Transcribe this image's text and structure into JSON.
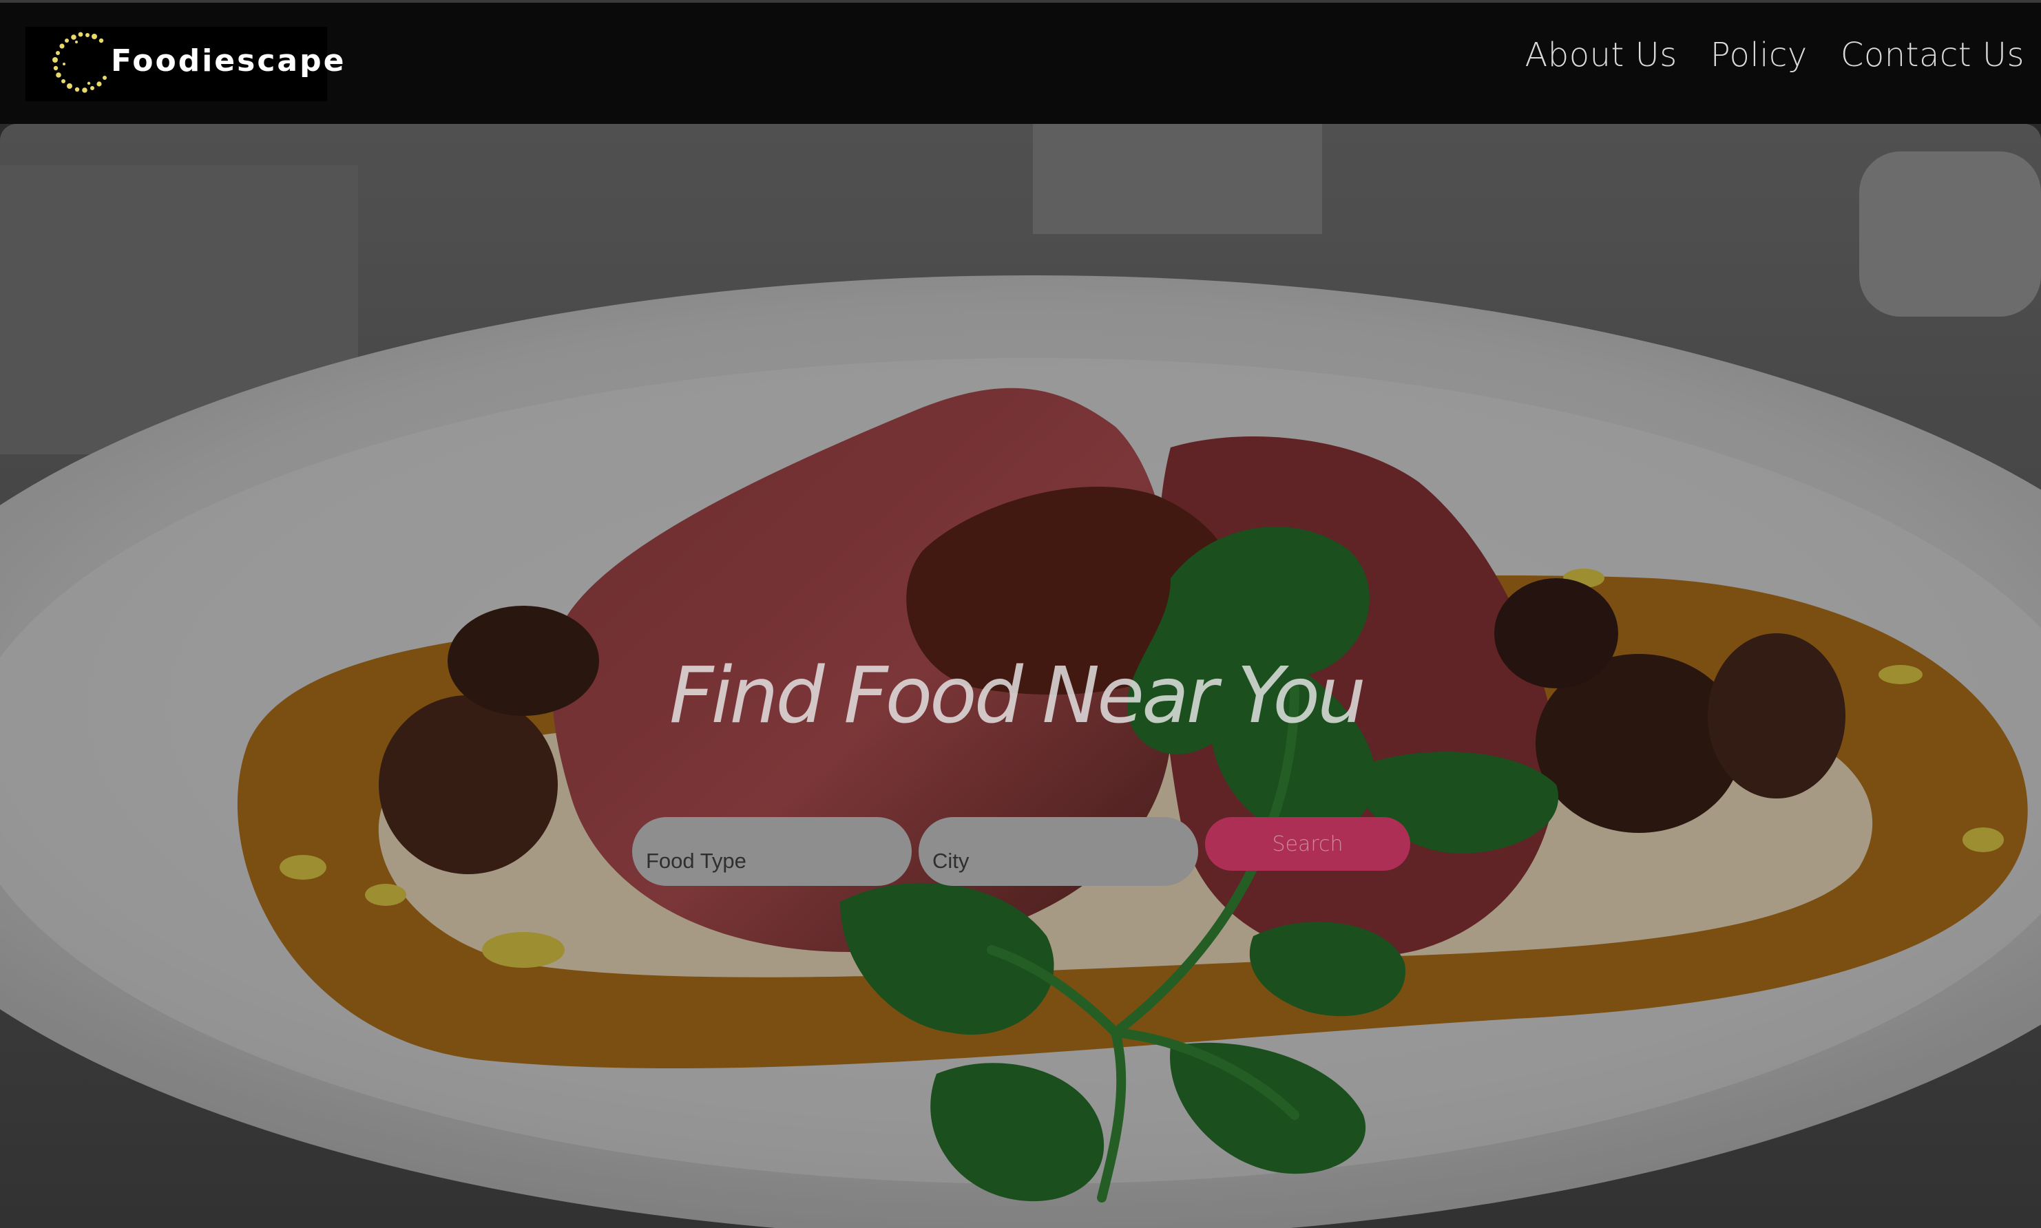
{
  "header": {
    "brand": "Foodiescape",
    "nav": [
      {
        "label": "About Us"
      },
      {
        "label": "Policy"
      },
      {
        "label": "Contact Us"
      }
    ]
  },
  "hero": {
    "title": "Find Food Near You",
    "search": {
      "food_type_placeholder": "Food Type",
      "city_placeholder": "City",
      "button_label": "Search"
    }
  },
  "colors": {
    "topbar_background": "#0a0a0a",
    "search_button": "#ad2f55",
    "input_background": "#8e8e8e",
    "logo_dots": "#e8d96a"
  },
  "icons": {
    "logo": "dotted-circle-logo-icon"
  }
}
